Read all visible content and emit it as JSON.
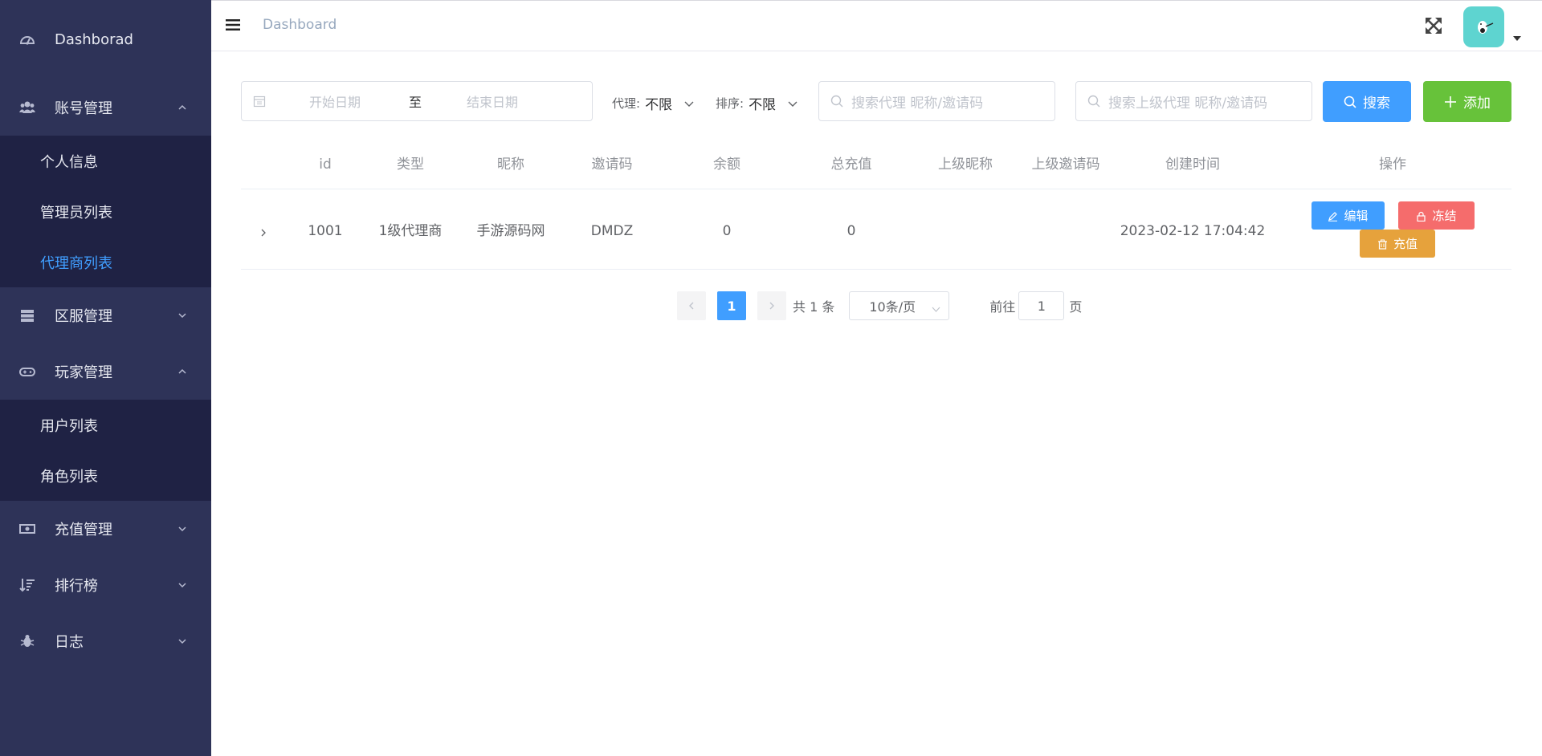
{
  "sidebar": {
    "items": [
      {
        "label": "Dashborad",
        "icon": "dashboard-icon"
      },
      {
        "label": "账号管理",
        "icon": "users-icon",
        "expanded": true,
        "children": [
          "个人信息",
          "管理员列表",
          "代理商列表"
        ],
        "active_child": "代理商列表"
      },
      {
        "label": "区服管理",
        "icon": "server-icon",
        "expanded": false
      },
      {
        "label": "玩家管理",
        "icon": "gamepad-icon",
        "expanded": true,
        "children": [
          "用户列表",
          "角色列表"
        ]
      },
      {
        "label": "充值管理",
        "icon": "money-icon",
        "expanded": false
      },
      {
        "label": "排行榜",
        "icon": "sort-icon",
        "expanded": false
      },
      {
        "label": "日志",
        "icon": "bug-icon",
        "expanded": false
      }
    ]
  },
  "header": {
    "breadcrumb": "Dashboard"
  },
  "filters": {
    "start_placeholder": "开始日期",
    "range_separator": "至",
    "end_placeholder": "结束日期",
    "agent_label": "代理:",
    "agent_value": "不限",
    "sort_label": "排序:",
    "sort_value": "不限",
    "search_agent_placeholder": "搜索代理 昵称/邀请码",
    "search_parent_placeholder": "搜索上级代理 昵称/邀请码",
    "search_button": "搜索",
    "add_button": "添加"
  },
  "table": {
    "columns": [
      "id",
      "类型",
      "昵称",
      "邀请码",
      "余额",
      "总充值",
      "上级昵称",
      "上级邀请码",
      "创建时间",
      "操作"
    ],
    "rows": [
      {
        "id": "1001",
        "type": "1级代理商",
        "nickname": "手游源码网",
        "invite_code": "DMDZ",
        "balance": "0",
        "total_recharge": "0",
        "parent_nickname": "",
        "parent_invite_code": "",
        "created": "2023-02-12 17:04:42"
      }
    ],
    "actions": {
      "edit": "编辑",
      "freeze": "冻结",
      "recharge": "充值"
    }
  },
  "pagination": {
    "current_page": "1",
    "total_text": "共 1 条",
    "page_size": "10条/页",
    "goto_label": "前往",
    "goto_value": "1",
    "page_suffix": "页"
  },
  "colors": {
    "sidebar_bg": "#2e3358",
    "submenu_bg": "#1f2244",
    "primary": "#409eff",
    "success": "#67c23a",
    "danger": "#f56c6c",
    "warning": "#e6a23c",
    "avatar_bg": "#5ed4d0"
  }
}
